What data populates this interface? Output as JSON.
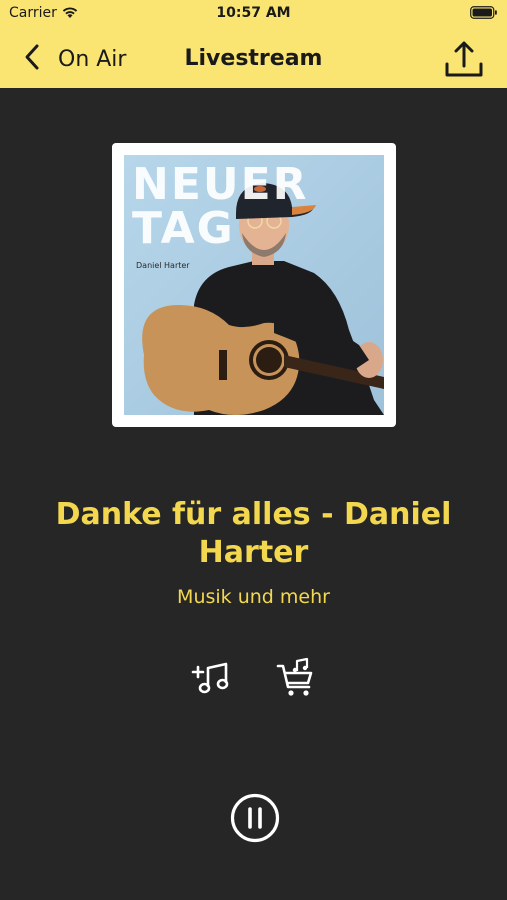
{
  "status_bar": {
    "carrier": "Carrier",
    "time": "10:57 AM"
  },
  "navbar": {
    "back_label": "On Air",
    "title": "Livestream"
  },
  "cover": {
    "title": "NEUER\nTAG",
    "artist": "Daniel Harter"
  },
  "track": {
    "title": "Danke für alles - Daniel Harter",
    "subtitle": "Musik und mehr"
  },
  "icons": {
    "back": "chevron-left-icon",
    "share": "share-upload-icon",
    "add_song": "add-music-icon",
    "shop": "shopping-cart-music-icon",
    "pause": "pause-circle-icon"
  },
  "colors": {
    "topbar": "#fbe572",
    "background": "#262626",
    "accent": "#f3d84f",
    "icon": "#ffffff"
  }
}
